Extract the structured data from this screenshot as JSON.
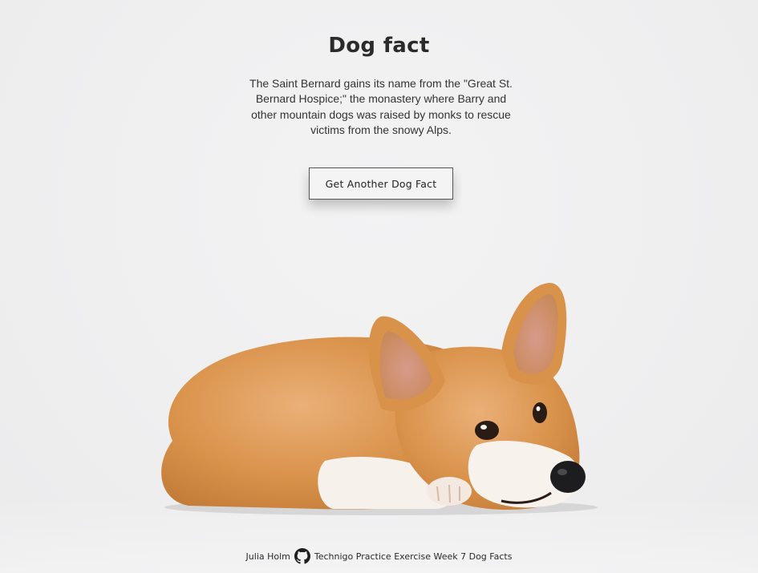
{
  "heading": "Dog fact",
  "fact": {
    "text": "The Saint Bernard gains its name from the \"Great St. Bernard Hospice;\" the monastery where Barry and other mountain dogs was raised by monks to rescue victims from the snowy Alps."
  },
  "button": {
    "label": "Get Another Dog Fact"
  },
  "footer": {
    "author": "Julia Holm",
    "icon": "github-icon",
    "project": "Technigo Practice Exercise Week 7 Dog Facts"
  },
  "colors": {
    "background": "#efeff0",
    "text": "#2b2b2b",
    "dog_fur": "#d9924a",
    "dog_white": "#f6f1ea"
  }
}
